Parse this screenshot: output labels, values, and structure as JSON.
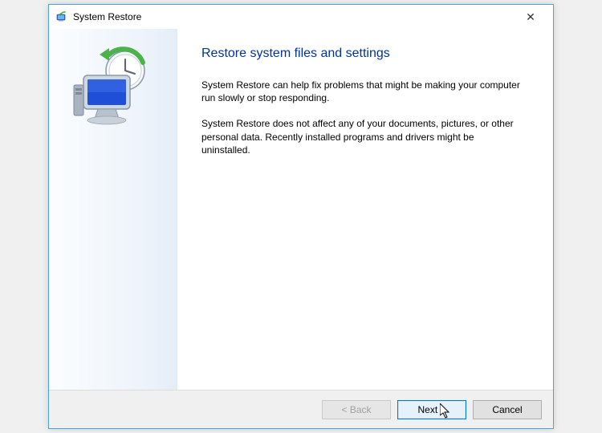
{
  "window": {
    "title": "System Restore"
  },
  "content": {
    "heading": "Restore system files and settings",
    "para1": "System Restore can help fix problems that might be making your computer run slowly or stop responding.",
    "para2": "System Restore does not affect any of your documents, pictures, or other personal data. Recently installed programs and drivers might be uninstalled."
  },
  "buttons": {
    "back": "< Back",
    "next": "Next >",
    "cancel": "Cancel"
  }
}
